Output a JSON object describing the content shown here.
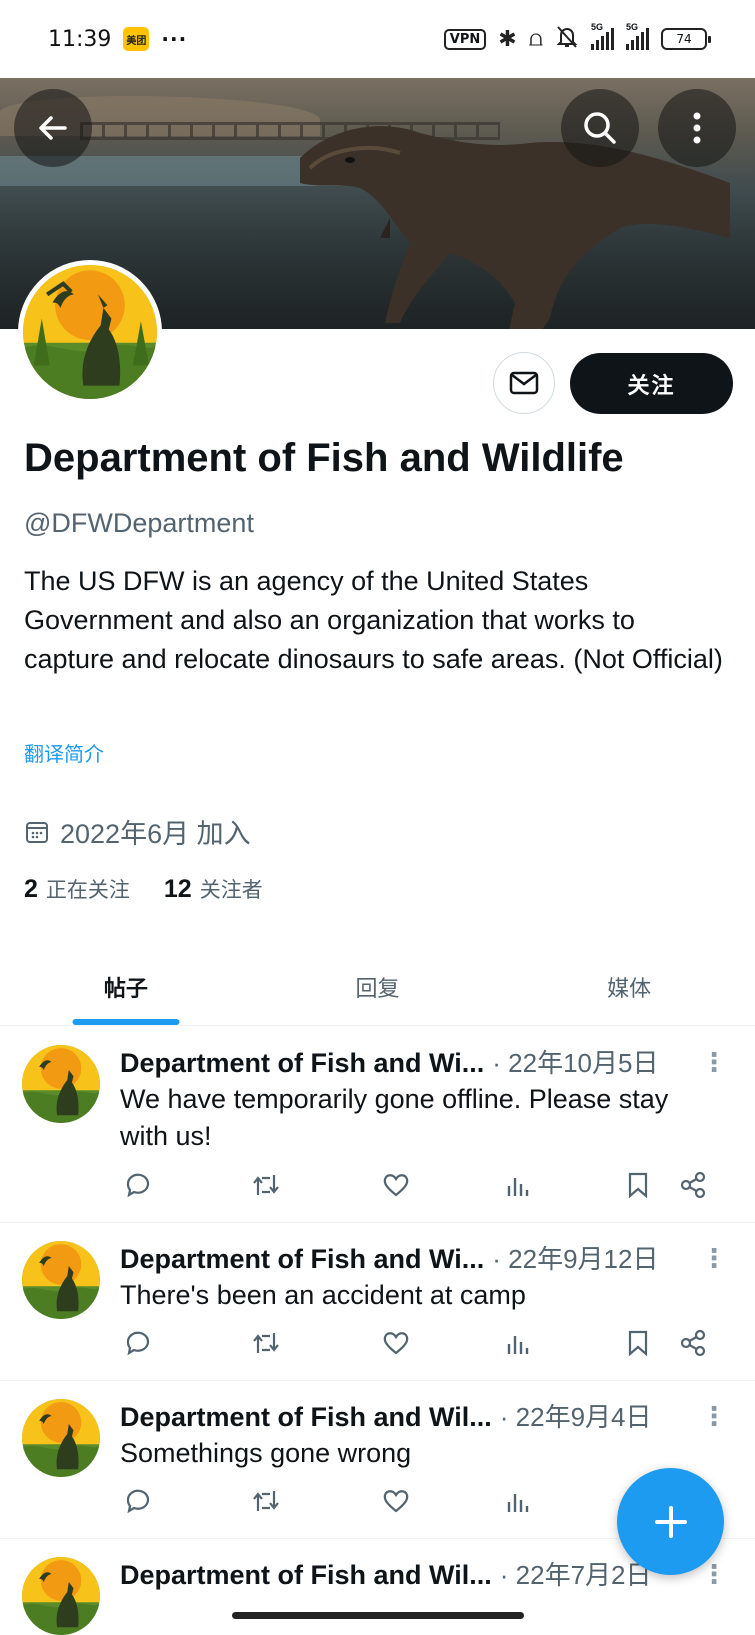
{
  "status_bar": {
    "time": "11:39",
    "app_badge": "美团",
    "dots": "···",
    "vpn": "VPN",
    "signal1": "5G",
    "signal2": "5G",
    "battery": "74"
  },
  "header": {
    "back_icon": "arrow-left-icon",
    "search_icon": "search-icon",
    "more_icon": "more-vertical-icon"
  },
  "profile": {
    "follow_label": "关注",
    "display_name": "Department of Fish and Wildlife",
    "handle": "@DFWDepartment",
    "bio": "The US DFW is an agency of the United States Government and also an organization that works to capture and relocate dinosaurs to safe areas.  (Not Official)",
    "translate_label": "翻译简介",
    "joined": "2022年6月 加入",
    "following_count": "2",
    "following_label": "正在关注",
    "followers_count": "12",
    "followers_label": "关注者"
  },
  "tabs": [
    {
      "label": "帖子",
      "active": true
    },
    {
      "label": "回复",
      "active": false
    },
    {
      "label": "媒体",
      "active": false
    }
  ],
  "posts": [
    {
      "author": "Department of Fish and Wi...",
      "date": "· 22年10月5日",
      "text": "We have temporarily gone offline. Please stay with us!"
    },
    {
      "author": "Department of Fish and Wi...",
      "date": "· 22年9月12日",
      "text": "There's been an accident at camp"
    },
    {
      "author": "Department of Fish and Wil...",
      "date": "· 22年9月4日",
      "text": "Somethings gone wrong"
    },
    {
      "author": "Department of Fish and Wil...",
      "date": "· 22年7月2日",
      "text": ""
    }
  ],
  "colors": {
    "accent": "#1d9bf0",
    "text_primary": "#0f1419",
    "text_secondary": "#536471"
  }
}
